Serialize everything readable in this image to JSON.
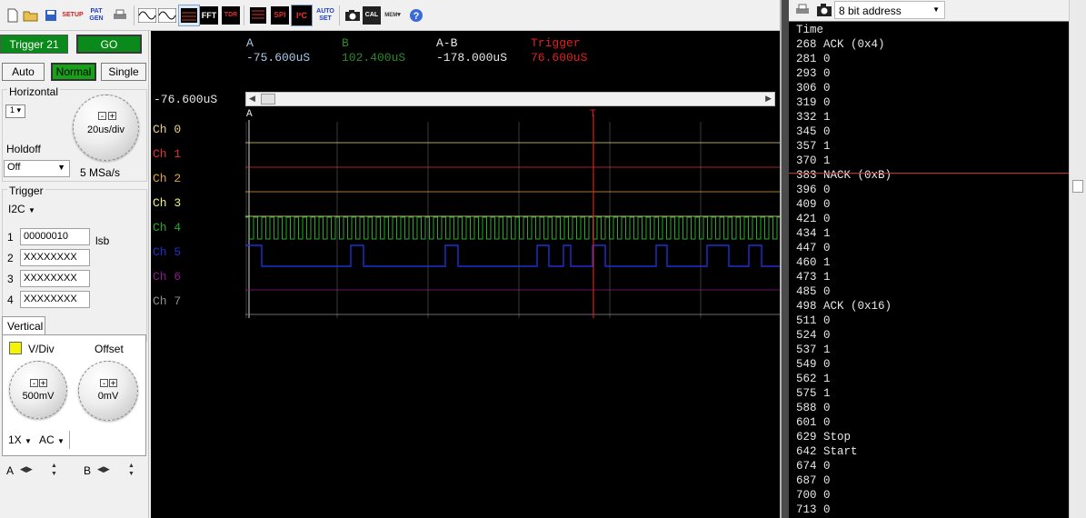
{
  "toolbar": {
    "icons": [
      "new-icon",
      "open-icon",
      "save-icon",
      "setup-icon",
      "pattern-gen-icon",
      "print-icon",
      "sine-icon",
      "square-icon",
      "scope-display-icon",
      "fft-icon",
      "tdr-icon",
      "logic-load-icon",
      "spi-icon",
      "i2c-icon",
      "autoset-icon",
      "camera-icon",
      "calibrate-icon",
      "memory-icon",
      "help-icon"
    ],
    "setup_label": "SETUP",
    "pat_label": "PAT",
    "gen_label": "GEN",
    "fft_label": "FFT",
    "tdr_label": "TDR",
    "spi_label": "SPI",
    "i2c_label": "I²C",
    "auto_label": "AUTO",
    "set_label": "SET",
    "cal_label": "CAL",
    "mem_label": "MEM"
  },
  "left": {
    "trigger_status": "Trigger 21",
    "go_label": "GO",
    "mode_auto": "Auto",
    "mode_normal": "Normal",
    "mode_single": "Single",
    "horizontal_title": "Horizontal",
    "timebase": "20us/div",
    "holdoff_title": "Holdoff",
    "holdoff_value": "Off",
    "sample_rate": "5 MSa/s",
    "trigger_title": "Trigger",
    "trigger_type": "I2C",
    "fields": [
      {
        "n": "1",
        "value": "00000010"
      },
      {
        "n": "2",
        "value": "XXXXXXXX"
      },
      {
        "n": "3",
        "value": "XXXXXXXX"
      },
      {
        "n": "4",
        "value": "XXXXXXXX"
      }
    ],
    "lsb_label": "lsb",
    "vertical_tab": "Vertical",
    "vdiv_title": "V/Div",
    "offset_title": "Offset",
    "vdiv_value": "500mV",
    "offset_value": "0mV",
    "probe": "1X",
    "coupling": "AC",
    "cursor_a": "A",
    "cursor_b": "B",
    "swatch_color": "#f4f400"
  },
  "scope": {
    "cursor_a_label": "A",
    "cursor_b_label": "B",
    "diff_label": "A-B",
    "trigger_label": "Trigger",
    "a_value": "-75.600uS",
    "b_value": "102.400uS",
    "diff_value": "-178.000uS",
    "trigger_value": "76.600uS",
    "offset_readout": "-76.600uS",
    "marker_a": "A",
    "marker_t": "T",
    "channels": [
      {
        "name": "Ch 0",
        "color": "#e8d08a"
      },
      {
        "name": "Ch 1",
        "color": "#e03030"
      },
      {
        "name": "Ch 2",
        "color": "#e0a040"
      },
      {
        "name": "Ch 3",
        "color": "#f0f080"
      },
      {
        "name": "Ch 4",
        "color": "#2aa82a"
      },
      {
        "name": "Ch 5",
        "color": "#2030d0"
      },
      {
        "name": "Ch 6",
        "color": "#8a1a8a"
      },
      {
        "name": "Ch 7",
        "color": "#909090"
      }
    ]
  },
  "decoder": {
    "mode": "8 bit address",
    "rows": [
      "Time",
      "268 ACK (0x4)",
      "281 0",
      "293 0",
      "306 0",
      "319 0",
      "332 1",
      "345 0",
      "357 1",
      "370 1",
      "383 NACK (0xB)",
      "396 0",
      "409 0",
      "421 0",
      "434 1",
      "447 0",
      "460 1",
      "473 1",
      "485 0",
      "498 ACK (0x16)",
      "511 0",
      "524 0",
      "537 1",
      "549 0",
      "562 1",
      "575 1",
      "588 0",
      "601 0",
      "629 Stop",
      "642 Start",
      "674 0",
      "687 0",
      "700 0",
      "713 0"
    ]
  }
}
